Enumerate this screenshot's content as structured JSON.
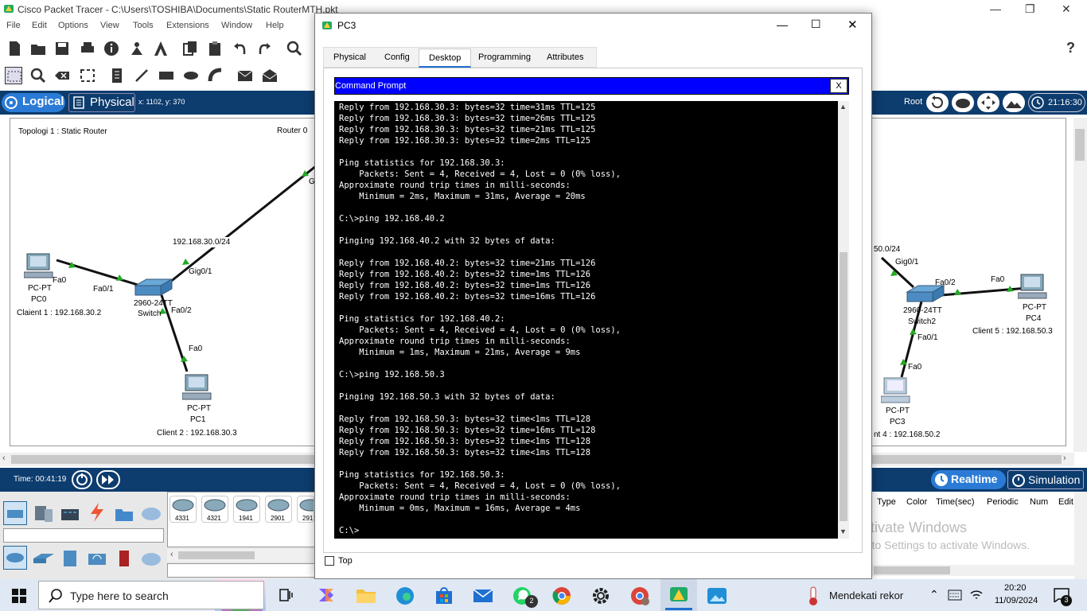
{
  "app": {
    "title": "Cisco Packet Tracer - C:\\Users\\TOSHIBA\\Documents\\Static RouterMTH.pkt",
    "menu": [
      "File",
      "Edit",
      "Options",
      "View",
      "Tools",
      "Extensions",
      "Window",
      "Help"
    ],
    "help_glyph": "?"
  },
  "workspace": {
    "logical_label": "Logical",
    "physical_label": "Physical",
    "coords": "x: 1102, y: 370",
    "root_label": "Root",
    "clock": "21:16:30"
  },
  "topology": {
    "title": "Topologi 1 : Static Router",
    "router_label": "Router 0",
    "router_port": "G",
    "net_left": "192.168.30.0/24",
    "net_right": "50.0/24",
    "switch1": {
      "model": "2960-24TT",
      "name": "Switch"
    },
    "switch2": {
      "model": "2960-24TT",
      "name": "Switch2"
    },
    "pc0": {
      "type": "PC-PT",
      "name": "PC0",
      "note": "Claient 1 : 192.168.30.2"
    },
    "pc1": {
      "type": "PC-PT",
      "name": "PC1",
      "note": "Client 2 : 192.168.30.3"
    },
    "pc3": {
      "type": "PC-PT",
      "name": "PC3",
      "note": "nt 4 : 192.168.50.2"
    },
    "pc4": {
      "type": "PC-PT",
      "name": "PC4",
      "note": "Client 5 : 192.168.50.3"
    },
    "ports": {
      "pc0_fa0": "Fa0",
      "sw1_fa01": "Fa0/1",
      "sw1_gig01": "Gig0/1",
      "sw1_fa02": "Fa0/2",
      "pc1_fa0": "Fa0",
      "sw2_gig01": "Gig0/1",
      "sw2_fa02": "Fa0/2",
      "pc4_fa0": "Fa0",
      "sw2_fa01": "Fa0/1",
      "pc3_fa0": "Fa0"
    }
  },
  "timebar": {
    "time": "Time: 00:41:19",
    "realtime": "Realtime",
    "simulation": "Simulation"
  },
  "device_models": [
    "4331",
    "4321",
    "1941",
    "2901",
    "291"
  ],
  "event_columns": [
    "Type",
    "Color",
    "Time(sec)",
    "Periodic",
    "Num",
    "Edit"
  ],
  "activation": {
    "title": "Activate Windows",
    "sub": "Go to Settings to activate Windows."
  },
  "pc3_window": {
    "title": "PC3",
    "tabs": [
      "Physical",
      "Config",
      "Desktop",
      "Programming",
      "Attributes"
    ],
    "active_tab": "Desktop",
    "cmd_title": "Command Prompt",
    "close_x": "X",
    "top_label": "Top",
    "terminal_lines": [
      "Reply from 192.168.30.3: bytes=32 time=31ms TTL=125",
      "Reply from 192.168.30.3: bytes=32 time=26ms TTL=125",
      "Reply from 192.168.30.3: bytes=32 time=21ms TTL=125",
      "Reply from 192.168.30.3: bytes=32 time=2ms TTL=125",
      "",
      "Ping statistics for 192.168.30.3:",
      "    Packets: Sent = 4, Received = 4, Lost = 0 (0% loss),",
      "Approximate round trip times in milli-seconds:",
      "    Minimum = 2ms, Maximum = 31ms, Average = 20ms",
      "",
      "C:\\>ping 192.168.40.2",
      "",
      "Pinging 192.168.40.2 with 32 bytes of data:",
      "",
      "Reply from 192.168.40.2: bytes=32 time=21ms TTL=126",
      "Reply from 192.168.40.2: bytes=32 time=1ms TTL=126",
      "Reply from 192.168.40.2: bytes=32 time=1ms TTL=126",
      "Reply from 192.168.40.2: bytes=32 time=16ms TTL=126",
      "",
      "Ping statistics for 192.168.40.2:",
      "    Packets: Sent = 4, Received = 4, Lost = 0 (0% loss),",
      "Approximate round trip times in milli-seconds:",
      "    Minimum = 1ms, Maximum = 21ms, Average = 9ms",
      "",
      "C:\\>ping 192.168.50.3",
      "",
      "Pinging 192.168.50.3 with 32 bytes of data:",
      "",
      "Reply from 192.168.50.3: bytes=32 time<1ms TTL=128",
      "Reply from 192.168.50.3: bytes=32 time=16ms TTL=128",
      "Reply from 192.168.50.3: bytes=32 time<1ms TTL=128",
      "Reply from 192.168.50.3: bytes=32 time<1ms TTL=128",
      "",
      "Ping statistics for 192.168.50.3:",
      "    Packets: Sent = 4, Received = 4, Lost = 0 (0% loss),",
      "Approximate round trip times in milli-seconds:",
      "    Minimum = 0ms, Maximum = 16ms, Average = 4ms",
      "",
      "C:\\>"
    ]
  },
  "taskbar": {
    "search_placeholder": "Type here to search",
    "weather": "Mendekati rekor",
    "time": "20:20",
    "date": "11/09/2024",
    "notifications": "3",
    "whatsapp_badge": "2"
  }
}
